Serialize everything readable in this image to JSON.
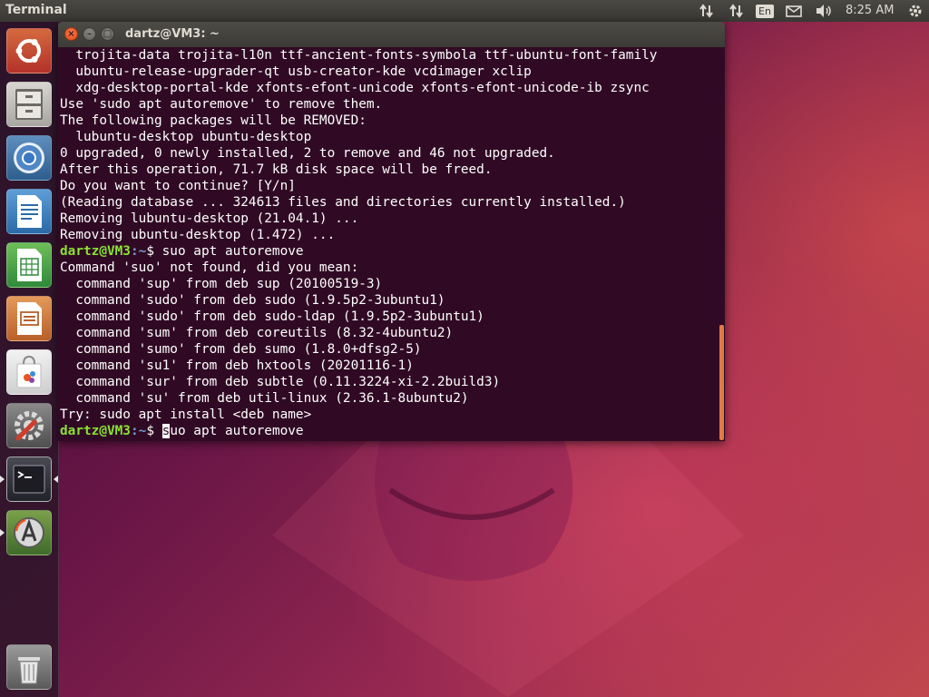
{
  "panel": {
    "app_title": "Terminal",
    "language": "En",
    "clock": "8:25 AM"
  },
  "launcher": {
    "items": [
      {
        "name": "dash-home",
        "icon": "ubuntu-logo-icon"
      },
      {
        "name": "files",
        "icon": "file-cabinet-icon"
      },
      {
        "name": "chromium",
        "icon": "chromium-icon"
      },
      {
        "name": "libreoffice-writer",
        "icon": "writer-document-icon"
      },
      {
        "name": "libreoffice-calc",
        "icon": "calc-spreadsheet-icon"
      },
      {
        "name": "libreoffice-impress",
        "icon": "impress-presentation-icon"
      },
      {
        "name": "software-center",
        "icon": "shopping-bag-icon"
      },
      {
        "name": "system-settings",
        "icon": "settings-wrench-icon"
      },
      {
        "name": "terminal",
        "icon": "terminal-prompt-icon"
      },
      {
        "name": "software-updater",
        "icon": "updater-icon"
      },
      {
        "name": "trash",
        "icon": "trash-icon"
      }
    ]
  },
  "terminal": {
    "title": "dartz@VM3: ~",
    "prompt": {
      "user": "dartz@VM3",
      "path": ":~",
      "symbol": "$ "
    },
    "lines": [
      {
        "type": "text",
        "text": "  trojita-data trojita-l10n ttf-ancient-fonts-symbola ttf-ubuntu-font-family"
      },
      {
        "type": "text",
        "text": "  ubuntu-release-upgrader-qt usb-creator-kde vcdimager xclip"
      },
      {
        "type": "text",
        "text": "  xdg-desktop-portal-kde xfonts-efont-unicode xfonts-efont-unicode-ib zsync"
      },
      {
        "type": "text",
        "text": "Use 'sudo apt autoremove' to remove them."
      },
      {
        "type": "text",
        "text": "The following packages will be REMOVED:"
      },
      {
        "type": "text",
        "text": "  lubuntu-desktop ubuntu-desktop"
      },
      {
        "type": "text",
        "text": "0 upgraded, 0 newly installed, 2 to remove and 46 not upgraded."
      },
      {
        "type": "text",
        "text": "After this operation, 71.7 kB disk space will be freed."
      },
      {
        "type": "text",
        "text": "Do you want to continue? [Y/n]"
      },
      {
        "type": "text",
        "text": "(Reading database ... 324613 files and directories currently installed.)"
      },
      {
        "type": "text",
        "text": "Removing lubuntu-desktop (21.04.1) ..."
      },
      {
        "type": "text",
        "text": "Removing ubuntu-desktop (1.472) ..."
      },
      {
        "type": "prompt",
        "command": "suo apt autoremove"
      },
      {
        "type": "text",
        "text": "Command 'suo' not found, did you mean:"
      },
      {
        "type": "text",
        "text": "  command 'sup' from deb sup (20100519-3)"
      },
      {
        "type": "text",
        "text": "  command 'sudo' from deb sudo (1.9.5p2-3ubuntu1)"
      },
      {
        "type": "text",
        "text": "  command 'sudo' from deb sudo-ldap (1.9.5p2-3ubuntu1)"
      },
      {
        "type": "text",
        "text": "  command 'sum' from deb coreutils (8.32-4ubuntu2)"
      },
      {
        "type": "text",
        "text": "  command 'sumo' from deb sumo (1.8.0+dfsg2-5)"
      },
      {
        "type": "text",
        "text": "  command 'su1' from deb hxtools (20201116-1)"
      },
      {
        "type": "text",
        "text": "  command 'sur' from deb subtle (0.11.3224-xi-2.2build3)"
      },
      {
        "type": "text",
        "text": "  command 'su' from deb util-linux (2.36.1-8ubuntu2)"
      },
      {
        "type": "text",
        "text": "Try: sudo apt install <deb name>"
      }
    ],
    "current_input": {
      "cursor_char": "s",
      "rest": "uo apt autoremove"
    },
    "colors": {
      "background": "#300a24",
      "foreground": "#ffffff",
      "prompt_user": "#8ae234",
      "prompt_path": "#729fcf",
      "scrollbar": "#e07a45"
    }
  }
}
